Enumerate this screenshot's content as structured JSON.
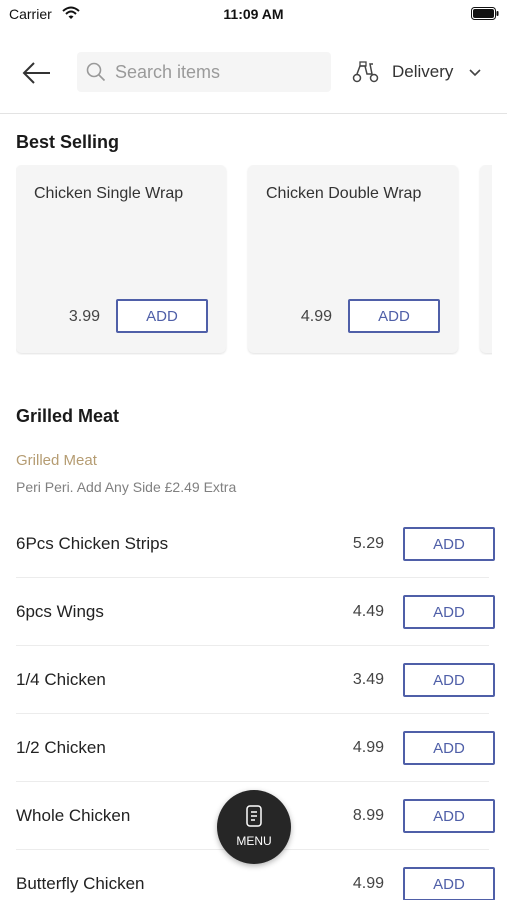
{
  "status_bar": {
    "carrier": "Carrier",
    "time": "11:09 AM"
  },
  "header": {
    "search_placeholder": "Search items",
    "delivery_label": "Delivery"
  },
  "best_selling": {
    "title": "Best Selling",
    "items": [
      {
        "name": "Chicken Single Wrap",
        "price": "3.99",
        "add_label": "ADD"
      },
      {
        "name": "Chicken Double Wrap",
        "price": "4.99",
        "add_label": "ADD"
      }
    ]
  },
  "grilled_meat": {
    "title": "Grilled Meat",
    "subtitle": "Grilled Meat",
    "description": "Peri Peri. Add Any Side £2.49 Extra",
    "items": [
      {
        "name": "6Pcs Chicken Strips",
        "price": "5.29",
        "add_label": "ADD"
      },
      {
        "name": "6pcs Wings",
        "price": "4.49",
        "add_label": "ADD"
      },
      {
        "name": "1/4 Chicken",
        "price": "3.49",
        "add_label": "ADD"
      },
      {
        "name": "1/2 Chicken",
        "price": "4.99",
        "add_label": "ADD"
      },
      {
        "name": "Whole Chicken",
        "price": "8.99",
        "add_label": "ADD"
      },
      {
        "name": "Butterfly Chicken",
        "price": "4.99",
        "add_label": "ADD"
      }
    ]
  },
  "menu_button": {
    "label": "MENU"
  },
  "colors": {
    "accent": "#4f5fa8",
    "subtitle": "#b59c72",
    "fab": "#262626"
  },
  "icons": [
    "wifi-icon",
    "battery-icon",
    "back-arrow-icon",
    "search-icon",
    "scooter-icon",
    "chevron-down-icon",
    "menu-icon"
  ]
}
